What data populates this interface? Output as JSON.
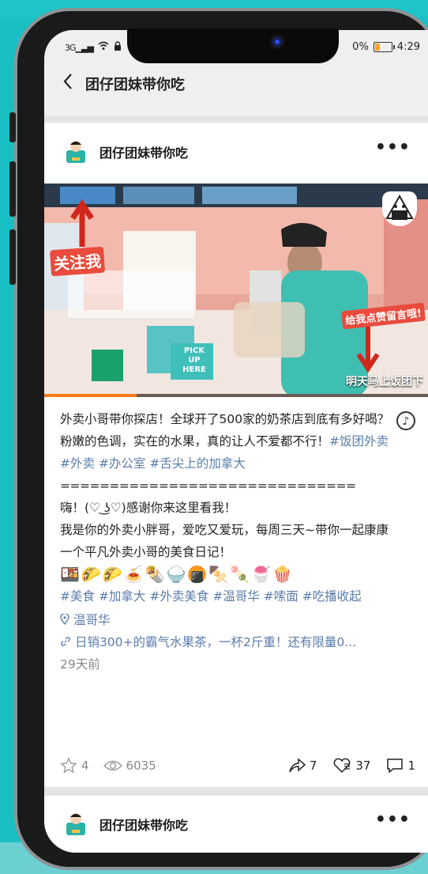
{
  "status_bar": {
    "signal": "3G",
    "battery": "0%",
    "time": "4:29"
  },
  "header": {
    "title": "团仔团妹带你吃"
  },
  "post": {
    "author": "团仔团妹带你吃",
    "video": {
      "follow_tag": "关注我",
      "like_tag": "给我点赞留言哦!",
      "caption": "明天马上饭团下",
      "pickup_sign": "PICK UP HERE",
      "progress": 0.24
    },
    "text_line1": "外卖小哥带你探店！全球开了500家的奶茶店到底有多好喝？粉嫩的色调，实在的水果，真的让人不爱都不行！",
    "hashtags1": [
      "#饭团外卖",
      "#外卖",
      "#办公室",
      "#舌尖上的加拿大"
    ],
    "divider": "==============================",
    "greeting": "嗨！(♡ ͜ʖ♡)感谢你来这里看我！",
    "intro": "我是你的外卖小胖哥，爱吃又爱玩，每周三天~带你一起康康一个平凡外卖小哥的美食日记！",
    "emojis": "🍱🌮🌮🍝🌯🍚🍘🍢🍡🍧🍿",
    "hashtags2": [
      "#美食",
      "#加拿大",
      "#外卖美食",
      "#温哥华",
      "#嗦面",
      "#吃播收起"
    ],
    "location": "温哥华",
    "link": "日销300+的霸气水果茶，一杯2斤重！还有限量0...",
    "time_ago": "29天前",
    "stats": {
      "favorites": "4",
      "views": "6035",
      "shares": "7",
      "likes": "37",
      "comments": "1"
    }
  },
  "next_post": {
    "author": "团仔团妹带你吃"
  },
  "colors": {
    "background": "#19bfc3",
    "hashtag": "#5a7cab",
    "video_progress": "#ff7a1a"
  }
}
